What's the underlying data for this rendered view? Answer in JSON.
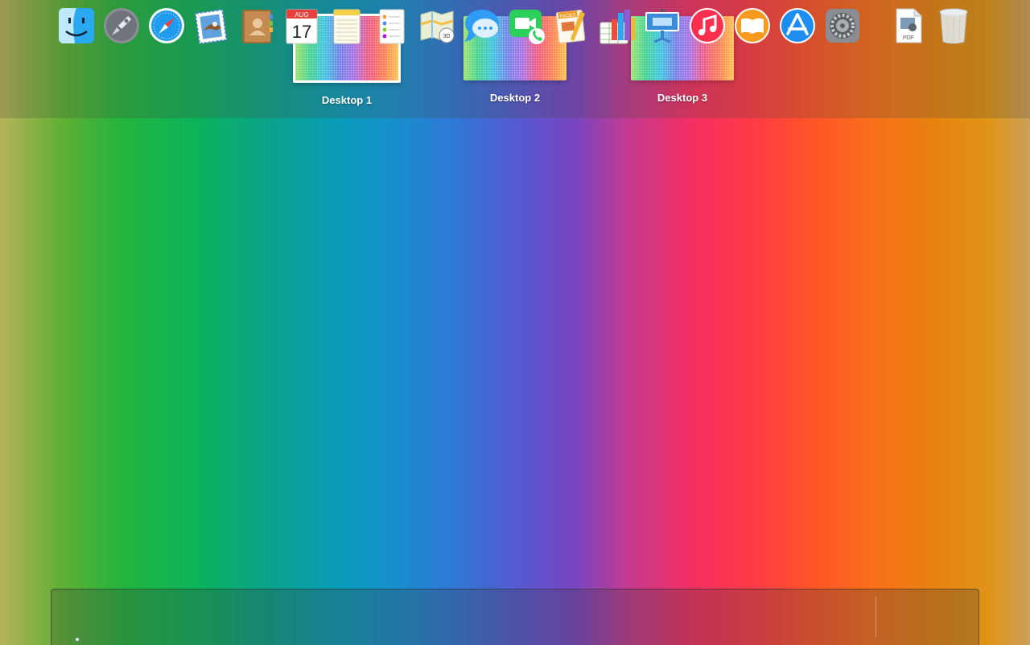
{
  "mission_control": {
    "spaces": [
      {
        "label": "Desktop 1",
        "active": true
      },
      {
        "label": "Desktop 2",
        "active": false
      },
      {
        "label": "Desktop 3",
        "active": false
      }
    ]
  },
  "dock": {
    "apps": [
      {
        "name": "finder-icon",
        "running": true
      },
      {
        "name": "launchpad-icon"
      },
      {
        "name": "safari-icon"
      },
      {
        "name": "mail-icon"
      },
      {
        "name": "contacts-icon"
      },
      {
        "name": "calendar-icon",
        "month": "AUG",
        "day": "17"
      },
      {
        "name": "notes-icon"
      },
      {
        "name": "reminders-icon"
      },
      {
        "name": "maps-icon",
        "badge": "3D"
      },
      {
        "name": "messages-icon"
      },
      {
        "name": "facetime-icon"
      },
      {
        "name": "pages-icon",
        "tag": "PAGES"
      },
      {
        "name": "numbers-icon"
      },
      {
        "name": "keynote-icon"
      },
      {
        "name": "itunes-icon"
      },
      {
        "name": "ibooks-icon"
      },
      {
        "name": "app-store-icon"
      },
      {
        "name": "system-preferences-icon"
      }
    ],
    "documents": [
      {
        "name": "pdf-document-icon",
        "label": "PDF"
      }
    ],
    "trash": {
      "name": "trash-icon"
    }
  }
}
